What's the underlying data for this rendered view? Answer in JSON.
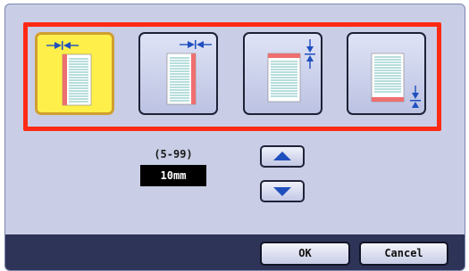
{
  "binding_options": [
    {
      "icon": "left-binding-selected-icon"
    },
    {
      "icon": "left-binding-icon"
    },
    {
      "icon": "top-binding-icon"
    },
    {
      "icon": "bottom-binding-icon"
    }
  ],
  "margin": {
    "range_label": "(5-99)",
    "value": "10mm"
  },
  "buttons": {
    "up_icon": "triangle-up-icon",
    "down_icon": "triangle-down-icon",
    "ok_label": "OK",
    "cancel_label": "Cancel"
  },
  "colors": {
    "panel_background": "#c9cee6",
    "selected_option": "#ffef4a",
    "highlight_frame": "#ff2a14",
    "bottom_bar": "#2e3457",
    "arrow_blue": "#1f4fbf",
    "binding_edge": "#ee6f6f",
    "page_lines": "#3fa9a0"
  }
}
